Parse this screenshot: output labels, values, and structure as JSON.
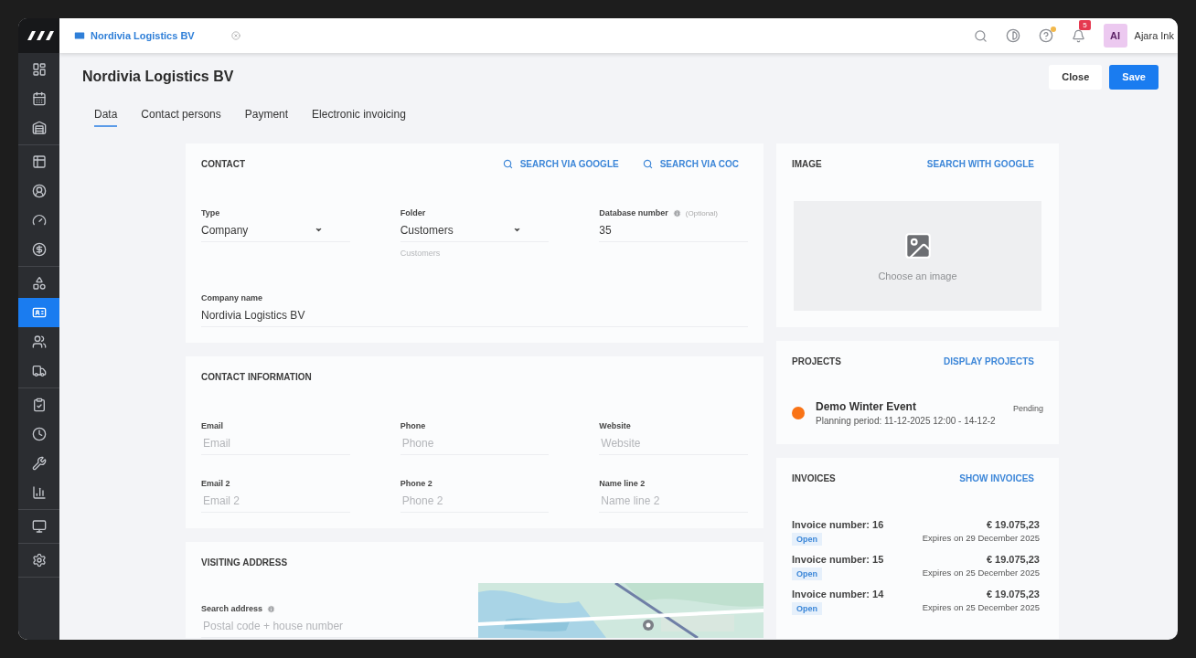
{
  "topbar": {
    "tab": {
      "label": "Nordivia Logistics BV"
    },
    "help": {
      "has_update": true
    },
    "notifications": {
      "badge": "5"
    },
    "user": {
      "initials": "AI",
      "name": "Ajara Ink"
    }
  },
  "sidebar": {
    "groups": [
      {
        "items": [
          {
            "selected": false
          },
          {
            "selected": false
          },
          {
            "selected": false
          }
        ]
      },
      {
        "items": [
          {
            "selected": false
          },
          {
            "selected": false
          },
          {
            "selected": false
          },
          {
            "selected": false
          }
        ]
      },
      {
        "items": [
          {
            "selected": false
          },
          {
            "selected": true
          },
          {
            "selected": false
          },
          {
            "selected": false
          }
        ]
      },
      {
        "items": [
          {
            "selected": false
          },
          {
            "selected": false
          },
          {
            "selected": false
          },
          {
            "selected": false
          }
        ]
      },
      {
        "items": [
          {
            "selected": false
          }
        ]
      },
      {
        "items": [
          {
            "selected": false
          }
        ]
      }
    ]
  },
  "page": {
    "title": "Nordivia Logistics BV",
    "buttons": [
      {
        "label": "Close",
        "kind": "secondary"
      },
      {
        "label": "Save",
        "kind": "primary"
      }
    ],
    "tabs": [
      {
        "label": "Data",
        "selected": true
      },
      {
        "label": "Contact persons",
        "selected": false
      },
      {
        "label": "Payment",
        "selected": false
      },
      {
        "label": "Electronic invoicing",
        "selected": false
      }
    ]
  },
  "contact": {
    "title": "CONTACT",
    "actions": [
      "SEARCH VIA GOOGLE",
      "SEARCH VIA COC"
    ],
    "rows": [
      [
        {
          "kind": "select",
          "label": "Type",
          "value": "Company"
        },
        {
          "kind": "select",
          "label": "Folder",
          "value": "Customers",
          "hint": "Customers"
        },
        {
          "label": "Database number",
          "info": true,
          "note": "(Optional)",
          "value": "35"
        }
      ],
      [
        {
          "label": "Company name",
          "value": "Nordivia Logistics BV"
        }
      ]
    ]
  },
  "contact_information": {
    "title": "CONTACT INFORMATION",
    "rows": [
      [
        {
          "label": "Email",
          "placeholder": "Email"
        },
        {
          "label": "Phone",
          "placeholder": "Phone"
        },
        {
          "label": "Website",
          "placeholder": "Website"
        }
      ],
      [
        {
          "label": "Email 2",
          "placeholder": "Email 2"
        },
        {
          "label": "Phone 2",
          "placeholder": "Phone 2"
        },
        {
          "label": "Name line 2",
          "placeholder": "Name line 2"
        }
      ]
    ]
  },
  "visiting_address": {
    "title": "VISITING ADDRESS",
    "search": {
      "label": "Search address",
      "info": true,
      "placeholder": "Postal code + house number"
    }
  },
  "image": {
    "title": "IMAGE",
    "action": "SEARCH WITH GOOGLE",
    "placeholder": "Choose an image"
  },
  "projects": {
    "title": "PROJECTS",
    "action": "DISPLAY PROJECTS",
    "items": [
      {
        "name": "Demo Winter Event",
        "period": "Planning period: 11-12-2025 12:00 - 14-12-2",
        "status": "Pending",
        "color": "#f97316"
      }
    ]
  },
  "invoices": {
    "title": "INVOICES",
    "action": "SHOW INVOICES",
    "items": [
      {
        "number": "Invoice number: 16",
        "amount": "€ 19.075,23",
        "status": "Open",
        "expires": "Expires on 29 December 2025"
      },
      {
        "number": "Invoice number: 15",
        "amount": "€ 19.075,23",
        "status": "Open",
        "expires": "Expires on 25 December 2025"
      },
      {
        "number": "Invoice number: 14",
        "amount": "€ 19.075,23",
        "status": "Open",
        "expires": "Expires on 25 December 2025"
      }
    ]
  }
}
